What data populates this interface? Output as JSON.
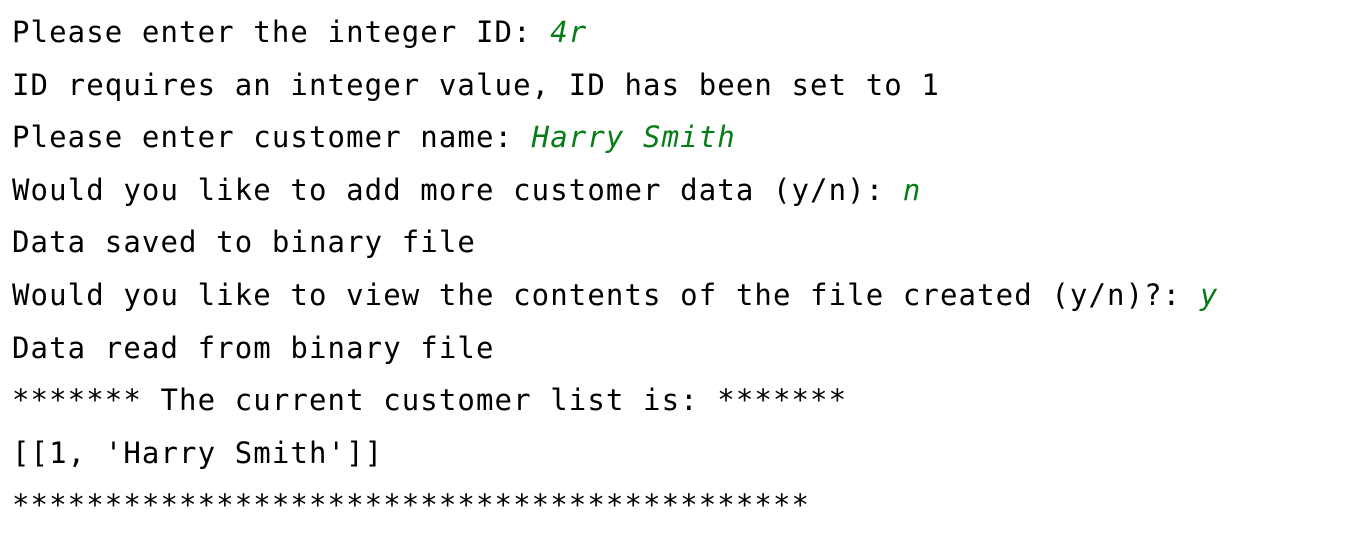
{
  "colors": {
    "background": "#ffffff",
    "output_text": "#000000",
    "user_input": "#067d17"
  },
  "console": {
    "lines": [
      {
        "prompt": "Please enter the integer ID: ",
        "input": "4r"
      },
      {
        "text": "ID requires an integer value, ID has been set to 1"
      },
      {
        "prompt": "Please enter customer name: ",
        "input": "Harry Smith"
      },
      {
        "prompt": "Would you like to add more customer data (y/n): ",
        "input": "n"
      },
      {
        "text": "Data saved to binary file"
      },
      {
        "prompt": "Would you like to view the contents of the file created (y/n)?: ",
        "input": "y"
      },
      {
        "text": "Data read from binary file"
      },
      {
        "text": "******* The current customer list is: *******"
      },
      {
        "text": "[[1, 'Harry Smith']]"
      },
      {
        "text": "*******************************************"
      }
    ]
  }
}
